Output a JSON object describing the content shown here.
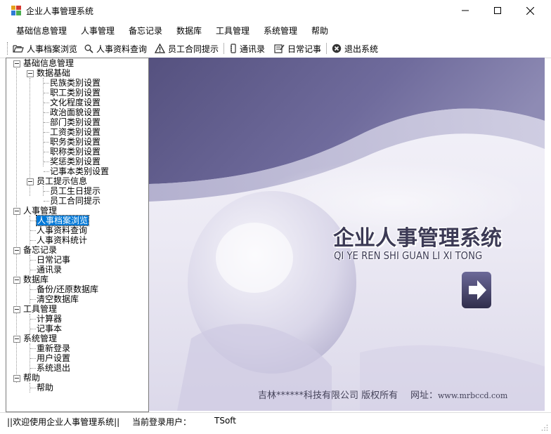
{
  "window": {
    "title": "企业人事管理系统"
  },
  "menu": [
    "基础信息管理",
    "人事管理",
    "备忘记录",
    "数据库",
    "工具管理",
    "系统管理",
    "帮助"
  ],
  "toolbar": [
    {
      "label": "人事档案浏览",
      "icon": "folder-open-icon"
    },
    {
      "label": "人事资料查询",
      "icon": "search-icon"
    },
    {
      "label": "员工合同提示",
      "icon": "warning-icon"
    },
    {
      "label": "通讯录",
      "icon": "address-book-icon"
    },
    {
      "label": "日常记事",
      "icon": "notepad-icon"
    },
    {
      "label": "退出系统",
      "icon": "exit-icon"
    }
  ],
  "tree": {
    "nodes": [
      {
        "label": "基础信息管理",
        "level": 0,
        "expanded": true
      },
      {
        "label": "数据基础",
        "level": 1,
        "expanded": true
      },
      {
        "label": "民族类别设置",
        "level": 2
      },
      {
        "label": "职工类别设置",
        "level": 2
      },
      {
        "label": "文化程度设置",
        "level": 2
      },
      {
        "label": "政治面貌设置",
        "level": 2
      },
      {
        "label": "部门类别设置",
        "level": 2
      },
      {
        "label": "工资类别设置",
        "level": 2
      },
      {
        "label": "职务类别设置",
        "level": 2
      },
      {
        "label": "职称类别设置",
        "level": 2
      },
      {
        "label": "奖惩类别设置",
        "level": 2
      },
      {
        "label": "记事本类别设置",
        "level": 2
      },
      {
        "label": "员工提示信息",
        "level": 1,
        "expanded": true
      },
      {
        "label": "员工生日提示",
        "level": 2
      },
      {
        "label": "员工合同提示",
        "level": 2
      },
      {
        "label": "人事管理",
        "level": 0,
        "expanded": true
      },
      {
        "label": "人事档案浏览",
        "level": 1,
        "selected": true
      },
      {
        "label": "人事资料查询",
        "level": 1
      },
      {
        "label": "人事资料统计",
        "level": 1
      },
      {
        "label": "备忘记录",
        "level": 0,
        "expanded": true
      },
      {
        "label": "日常记事",
        "level": 1
      },
      {
        "label": "通讯录",
        "level": 1
      },
      {
        "label": "数据库",
        "level": 0,
        "expanded": true
      },
      {
        "label": "备份/还原数据库",
        "level": 1
      },
      {
        "label": "清空数据库",
        "level": 1
      },
      {
        "label": "工具管理",
        "level": 0,
        "expanded": true
      },
      {
        "label": "计算器",
        "level": 1
      },
      {
        "label": "记事本",
        "level": 1
      },
      {
        "label": "系统管理",
        "level": 0,
        "expanded": true
      },
      {
        "label": "重新登录",
        "level": 1
      },
      {
        "label": "用户设置",
        "level": 1
      },
      {
        "label": "系统退出",
        "level": 1
      },
      {
        "label": "帮助",
        "level": 0,
        "expanded": true
      },
      {
        "label": "帮助",
        "level": 1
      }
    ]
  },
  "splash": {
    "title_cn": "企业人事管理系统",
    "title_pinyin": "QI YE REN SHI GUAN LI XI TONG",
    "copyright": "吉林******科技有限公司 版权所有",
    "website_label": "网址：",
    "website_url": "www.mrbccd.com"
  },
  "status": {
    "welcome": "||欢迎使用企业人事管理系统||",
    "user_label": "当前登录用户：",
    "user_name": "TSoft"
  },
  "colors": {
    "accent": "#0078d7",
    "splash_dark": "#5e5b8c",
    "splash_light": "#ecebf4"
  }
}
